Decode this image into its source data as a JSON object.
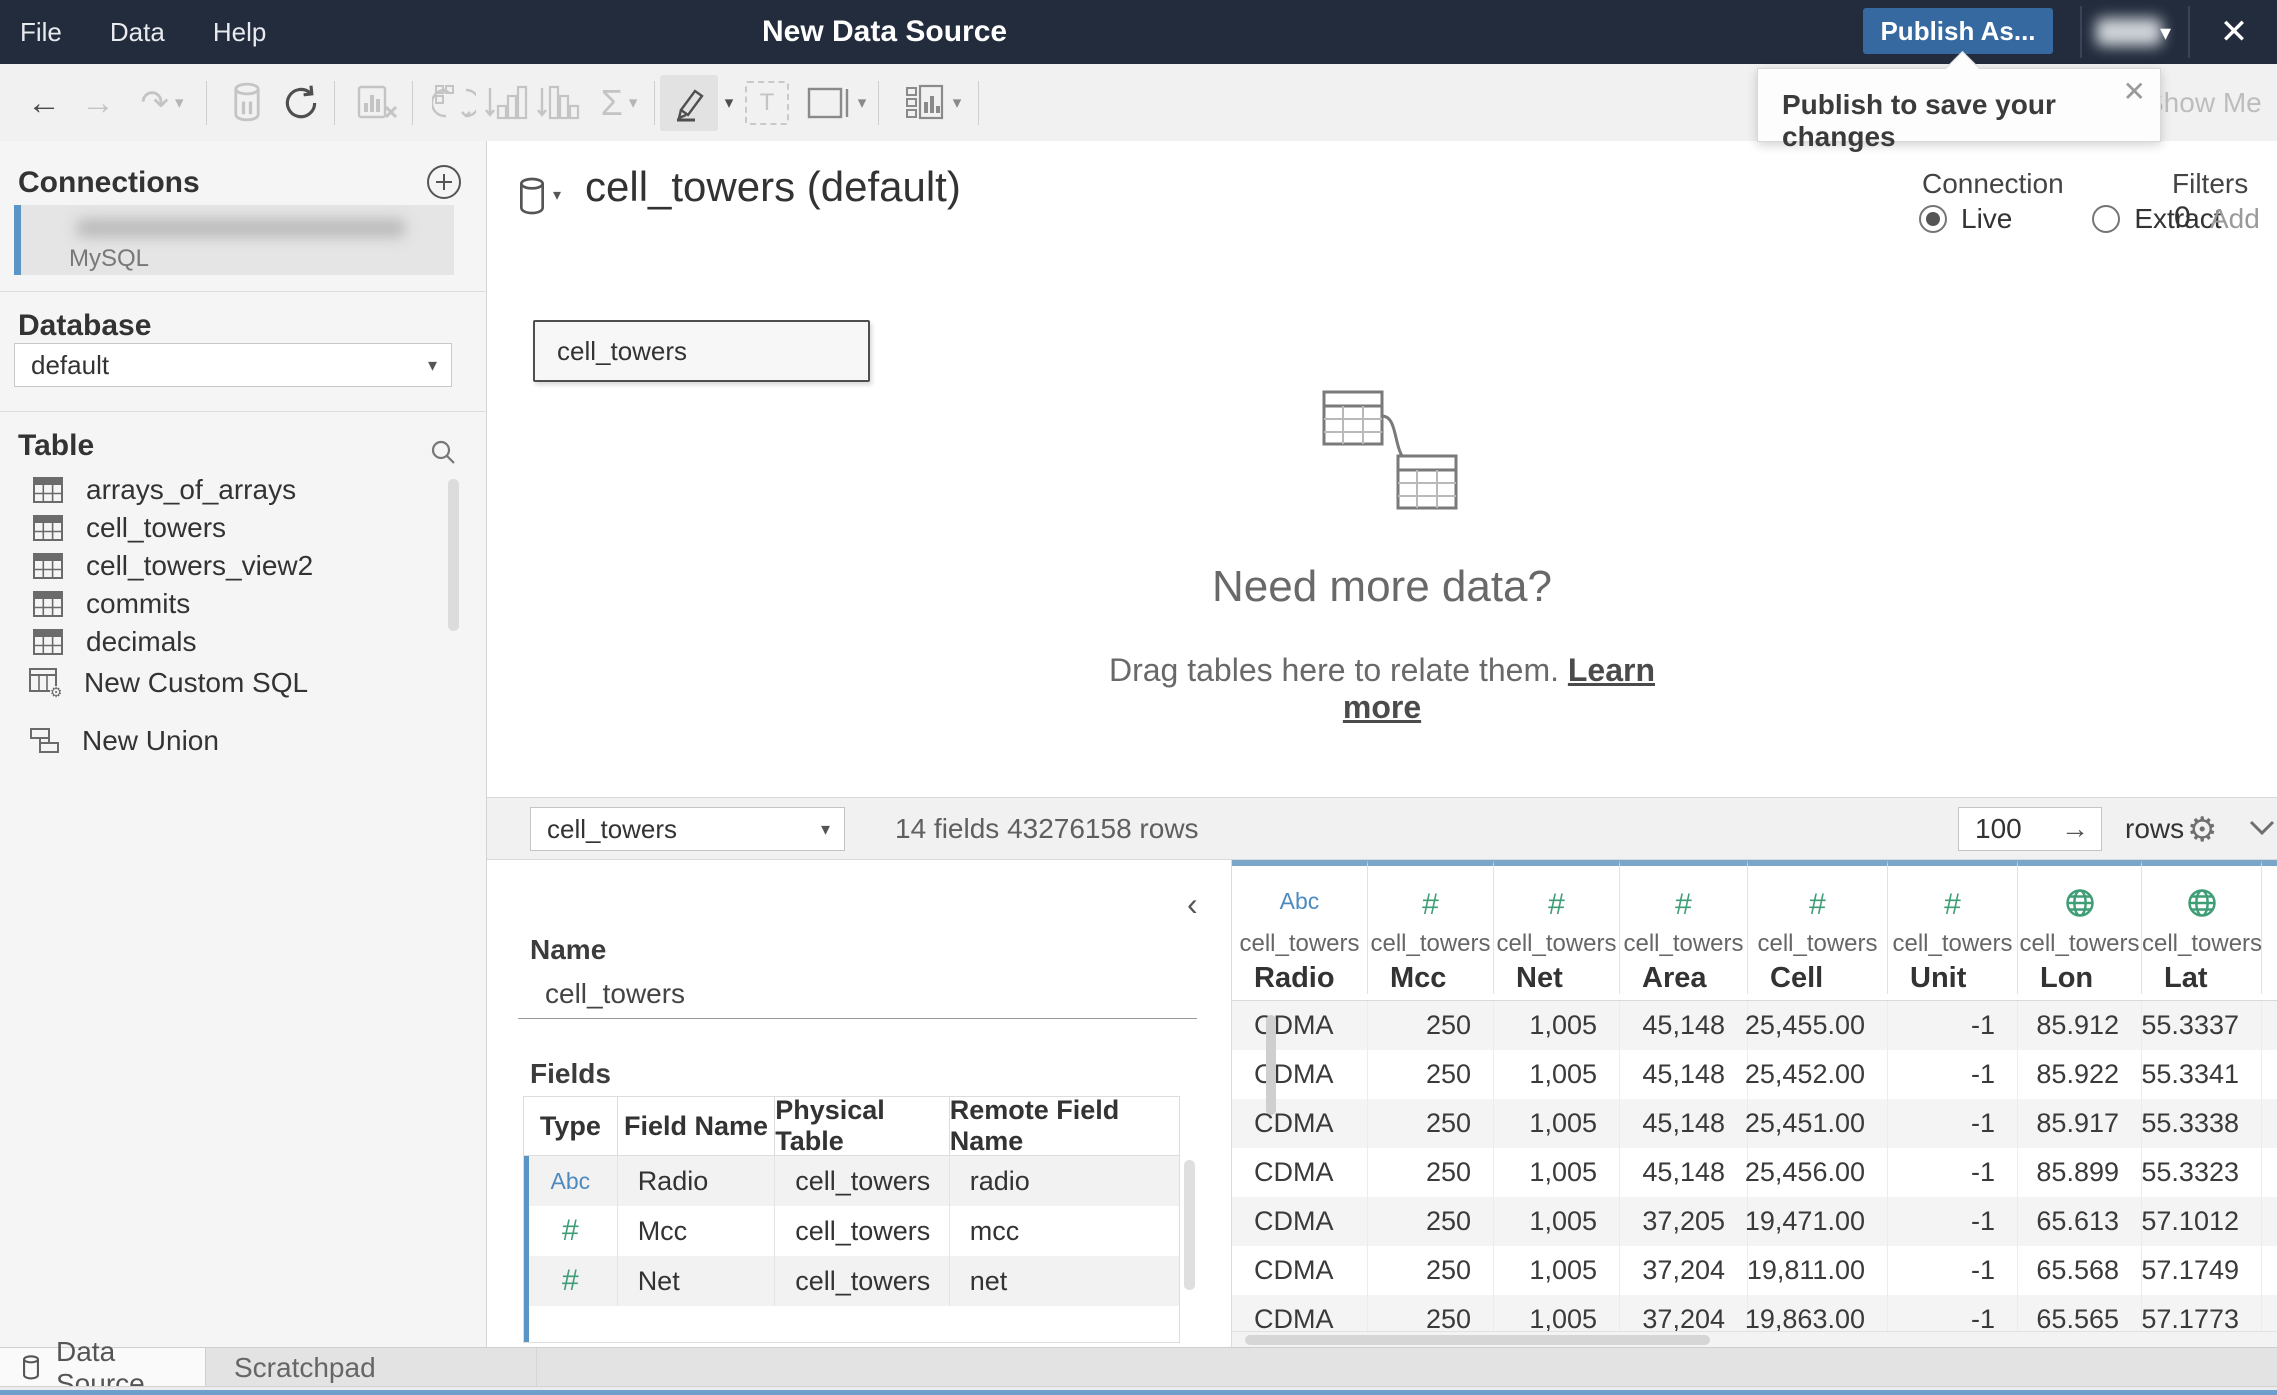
{
  "colors": {
    "titlebar_bg": "#222c3d",
    "publish_blue": "#35699f",
    "accent_blue": "#5a95c5",
    "header_blue": "#7aa6c9",
    "type_green": "#3f9e75",
    "type_blue": "#4f8abf"
  },
  "icons": {
    "close": "✕",
    "caret": "▾",
    "back": "←",
    "forward": "→",
    "redo": "↷",
    "sigma": "Σ",
    "gear": "⚙"
  },
  "titlebar": {
    "menus": [
      "File",
      "Data",
      "Help"
    ],
    "title": "New Data Source",
    "publish_label": "Publish As...",
    "tooltip_text": "Publish to save your changes"
  },
  "toolbar": {
    "show_me": "Show Me"
  },
  "sidebar": {
    "connections_header": "Connections",
    "connection": {
      "type": "MySQL"
    },
    "database_header": "Database",
    "database_value": "default",
    "table_header": "Table",
    "table_items": [
      "arrays_of_arrays",
      "cell_towers",
      "cell_towers_view2",
      "commits",
      "decimals"
    ],
    "new_custom_sql": "New Custom SQL",
    "new_union": "New Union"
  },
  "canvas": {
    "datasource_title": "cell_towers (default)",
    "connection_label": "Connection",
    "live_label": "Live",
    "extract_label": "Extract",
    "filters_label": "Filters",
    "filters_count": "0",
    "filters_add": "Add",
    "node_label": "cell_towers",
    "empty_title": "Need more data?",
    "empty_subtitle": "Drag tables here to relate them.",
    "empty_link": "Learn more"
  },
  "preview": {
    "table_select": "cell_towers",
    "summary": "14 fields 43276158 rows",
    "row_count": "100",
    "rows_label": "rows",
    "metadata": {
      "name_label": "Name",
      "name_value": "cell_towers",
      "fields_label": "Fields",
      "columns": [
        "Type",
        "Field Name",
        "Physical Table",
        "Remote Field Name"
      ],
      "rows": [
        {
          "type_icon": "Abc",
          "field": "Radio",
          "table": "cell_towers",
          "remote": "radio"
        },
        {
          "type_icon": "#",
          "field": "Mcc",
          "table": "cell_towers",
          "remote": "mcc"
        },
        {
          "type_icon": "#",
          "field": "Net",
          "table": "cell_towers",
          "remote": "net"
        }
      ]
    },
    "grid": {
      "columns": [
        {
          "type_icon": "Abc",
          "table": "cell_towers",
          "name": "Radio",
          "align": "left"
        },
        {
          "type_icon": "#",
          "table": "cell_towers",
          "name": "Mcc",
          "align": "right"
        },
        {
          "type_icon": "#",
          "table": "cell_towers",
          "name": "Net",
          "align": "right"
        },
        {
          "type_icon": "#",
          "table": "cell_towers",
          "name": "Area",
          "align": "right"
        },
        {
          "type_icon": "#",
          "table": "cell_towers",
          "name": "Cell",
          "align": "right"
        },
        {
          "type_icon": "#",
          "table": "cell_towers",
          "name": "Unit",
          "align": "right"
        },
        {
          "type_icon": "globe",
          "table": "cell_towers",
          "name": "Lon",
          "align": "right"
        },
        {
          "type_icon": "globe",
          "table": "cell_towers",
          "name": "Lat",
          "align": "right"
        }
      ],
      "rows": [
        [
          "CDMA",
          "250",
          "1,005",
          "45,148",
          "25,455.00",
          "-1",
          "85.912",
          "55.3337"
        ],
        [
          "CDMA",
          "250",
          "1,005",
          "45,148",
          "25,452.00",
          "-1",
          "85.922",
          "55.3341"
        ],
        [
          "CDMA",
          "250",
          "1,005",
          "45,148",
          "25,451.00",
          "-1",
          "85.917",
          "55.3338"
        ],
        [
          "CDMA",
          "250",
          "1,005",
          "45,148",
          "25,456.00",
          "-1",
          "85.899",
          "55.3323"
        ],
        [
          "CDMA",
          "250",
          "1,005",
          "37,205",
          "19,471.00",
          "-1",
          "65.613",
          "57.1012"
        ],
        [
          "CDMA",
          "250",
          "1,005",
          "37,204",
          "19,811.00",
          "-1",
          "65.568",
          "57.1749"
        ],
        [
          "CDMA",
          "250",
          "1,005",
          "37,204",
          "19,863.00",
          "-1",
          "65.565",
          "57.1773"
        ]
      ]
    }
  },
  "tabs": [
    {
      "label": "Data Source"
    },
    {
      "label": "Scratchpad"
    }
  ]
}
